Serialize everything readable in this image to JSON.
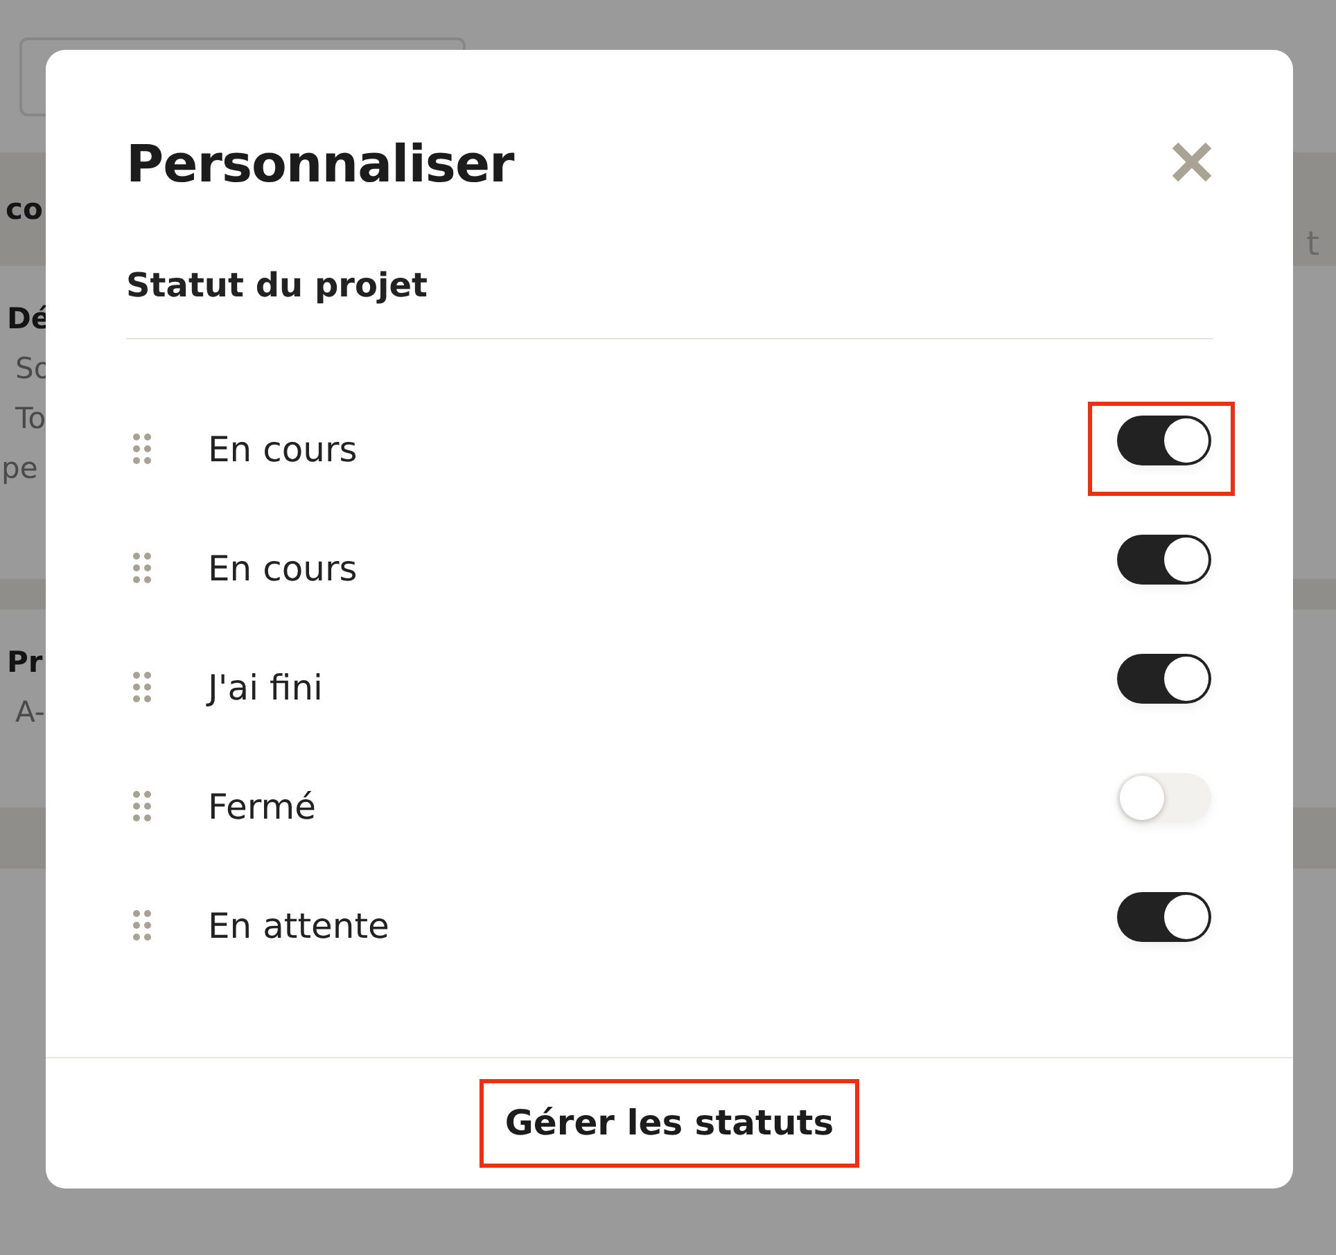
{
  "background": {
    "header_fragment": "co",
    "right_fragment": "t",
    "section_1": {
      "title": "Dé",
      "lines": [
        "So",
        "To",
        "pe"
      ]
    },
    "section_2": {
      "title": "Pr",
      "lines": [
        "A-"
      ]
    }
  },
  "modal": {
    "title": "Personnaliser",
    "section_title": "Statut du projet",
    "statuses": [
      {
        "label": "En cours",
        "on": true,
        "highlighted": true
      },
      {
        "label": "En cours",
        "on": true,
        "highlighted": false
      },
      {
        "label": "J'ai fini",
        "on": true,
        "highlighted": false
      },
      {
        "label": "Fermé",
        "on": false,
        "highlighted": false
      },
      {
        "label": "En attente",
        "on": true,
        "highlighted": false
      }
    ],
    "footer_button": {
      "label": "Gérer les statuts",
      "highlighted": true
    }
  }
}
